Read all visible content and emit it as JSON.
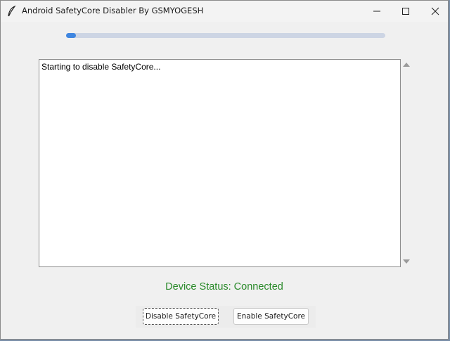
{
  "window": {
    "title": "Android SafetyCore Disabler By GSMYOGESH",
    "controls": {
      "minimize": "─",
      "maximize": "☐",
      "close": "✕"
    }
  },
  "progress": {
    "fraction": 0.03,
    "fill_color": "#3f86e0",
    "track_color": "#cdd5e4"
  },
  "log": {
    "lines": [
      "Starting to disable SafetyCore..."
    ]
  },
  "status": {
    "text": "Device Status: Connected",
    "color": "#2a8a2a"
  },
  "buttons": {
    "disable_label": "Disable SafetyCore",
    "enable_label": "Enable SafetyCore"
  },
  "icons": {
    "app_icon": "feather-icon",
    "scroll_up": "arrow-up-icon",
    "scroll_down": "arrow-down-icon"
  }
}
